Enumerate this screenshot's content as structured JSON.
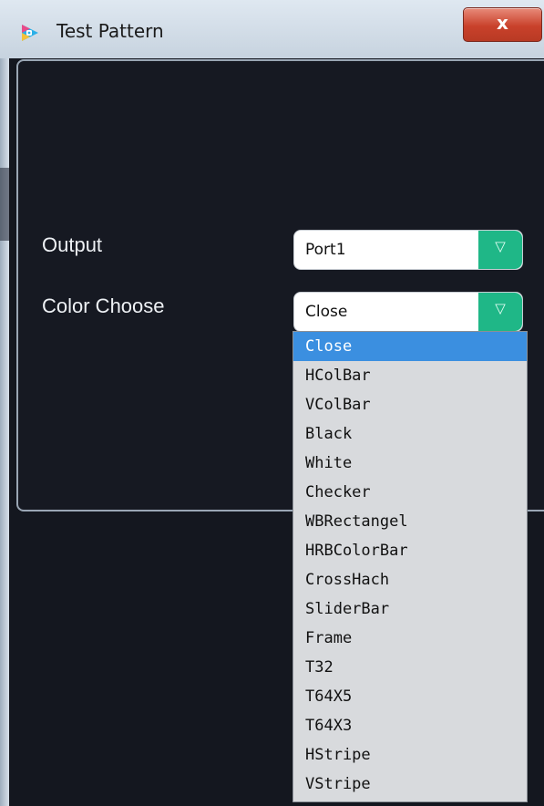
{
  "window": {
    "title": "Test Pattern",
    "close_glyph": "x"
  },
  "form": {
    "output_label": "Output",
    "output_value": "Port1",
    "color_label": "Color Choose",
    "color_value": "Close"
  },
  "dropdown": {
    "selected_index": 0,
    "options": [
      "Close",
      "HColBar",
      "VColBar",
      "Black",
      "White",
      "Checker",
      "WBRectangel",
      "HRBColorBar",
      "CrossHach",
      "SliderBar",
      "Frame",
      "T32",
      "T64X5",
      "T64X3",
      "HStripe",
      "VStripe"
    ]
  },
  "icons": {
    "app": "app-logo-icon",
    "close": "close-icon",
    "dropdown": "triangle-down-icon"
  },
  "colors": {
    "accent": "#1fb787",
    "selection": "#3b8fe0",
    "background": "#14171f",
    "close": "#c9412b"
  }
}
